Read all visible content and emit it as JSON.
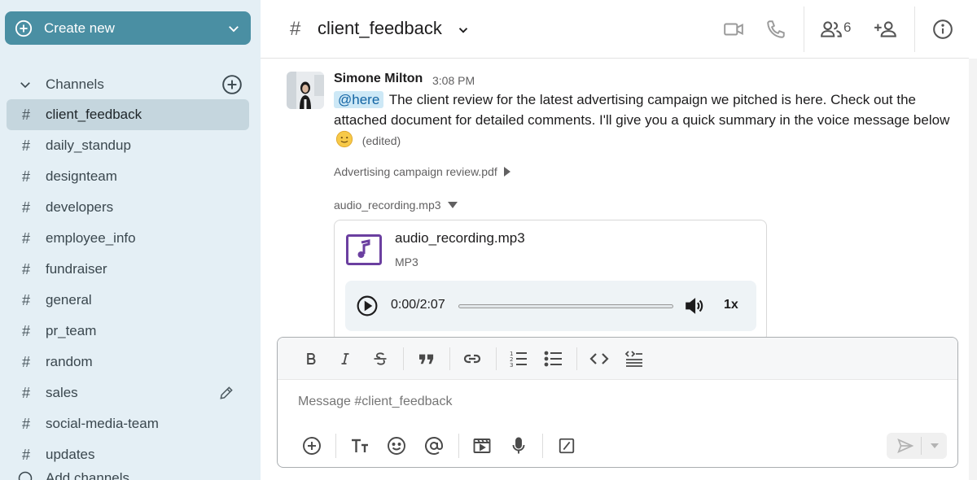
{
  "sidebar": {
    "create_label": "Create new",
    "channels_label": "Channels",
    "channels": [
      {
        "name": "client_feedback",
        "active": true
      },
      {
        "name": "daily_standup"
      },
      {
        "name": "designteam"
      },
      {
        "name": "developers"
      },
      {
        "name": "employee_info"
      },
      {
        "name": "fundraiser"
      },
      {
        "name": "general"
      },
      {
        "name": "pr_team"
      },
      {
        "name": "random"
      },
      {
        "name": "sales"
      },
      {
        "name": "social-media-team"
      },
      {
        "name": "updates"
      }
    ],
    "add_channel_label": "Add channels"
  },
  "header": {
    "channel_name": "client_feedback",
    "members_count": "6"
  },
  "message": {
    "author": "Simone Milton",
    "time": "3:08 PM",
    "mention": "@here",
    "text": "The client review for the latest advertising campaign we pitched is here. Check out the attached document for detailed comments. I'll give you a quick summary in the voice message below",
    "edited": "(edited)",
    "attachment_pdf": "Advertising campaign review.pdf",
    "attachment_audio": "audio_recording.mp3",
    "audio": {
      "file_name": "audio_recording.mp3",
      "file_type": "MP3",
      "time": "0:00/2:07",
      "speed": "1x",
      "progress": 0
    }
  },
  "composer": {
    "placeholder": "Message #client_feedback"
  },
  "colors": {
    "create_button": "#4a8fa3",
    "sidebar_bg": "#e4eff5",
    "active_channel": "#c5d6de",
    "mention_bg": "#cde8f6",
    "audio_icon": "#6b3fa0"
  }
}
